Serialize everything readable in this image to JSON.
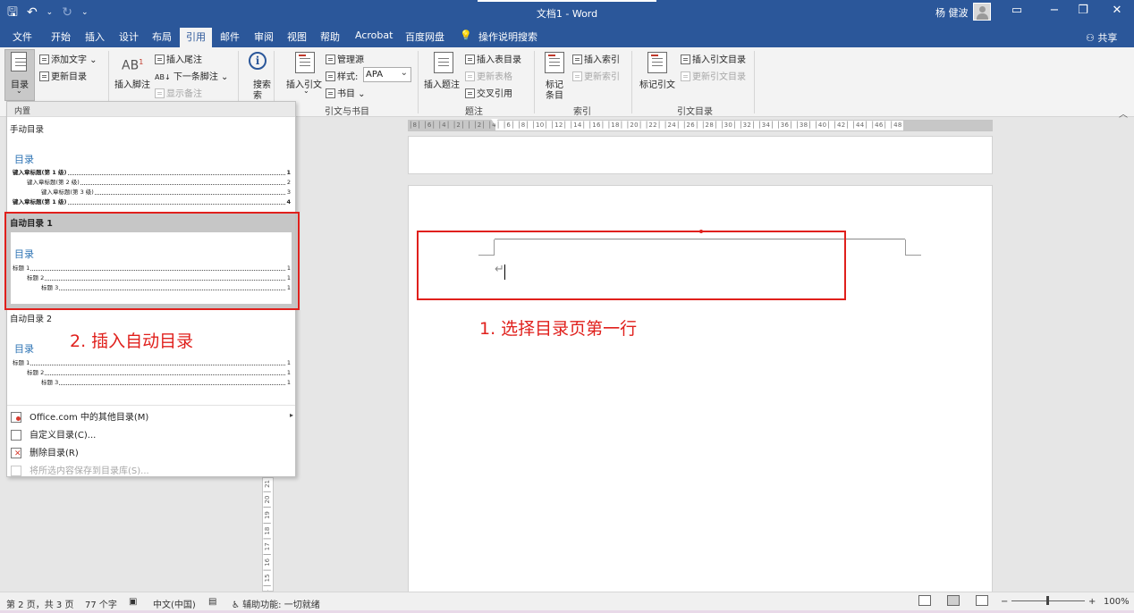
{
  "window": {
    "title": "文档1  -  Word",
    "user_name": "杨 健波",
    "controls": {
      "ribbon_options": "▭",
      "minimize": "−",
      "restore": "❐",
      "close": "✕"
    }
  },
  "qat": {
    "save": "🖫",
    "undo": "↶",
    "undo_more": "⌄",
    "redo": "↻",
    "customize": "⌄"
  },
  "tabs": [
    "文件",
    "开始",
    "插入",
    "设计",
    "布局",
    "引用",
    "邮件",
    "审阅",
    "视图",
    "帮助",
    "Acrobat",
    "百度网盘"
  ],
  "active_tab": "引用",
  "tell_me": "操作说明搜索",
  "share": "共享",
  "ribbon": {
    "toc": {
      "toc_button": "目录",
      "add_text": "添加文字",
      "update_toc": "更新目录"
    },
    "footnotes": {
      "insert_footnote": "插入脚注",
      "insert_endnote": "插入尾注",
      "next_footnote": "下一条脚注",
      "show_notes": "显示备注"
    },
    "research": {
      "search": "搜索"
    },
    "citations": {
      "insert_citation": "插入引文",
      "manage_sources": "管理源",
      "style_label": "样式:",
      "style_value": "APA",
      "bibliography": "书目",
      "group_label": "引文与书目"
    },
    "captions": {
      "insert_caption": "插入题注",
      "insert_table_of_figures": "插入表目录",
      "update_table": "更新表格",
      "cross_reference": "交叉引用",
      "group_label": "题注"
    },
    "index": {
      "mark_entry_line1": "标记",
      "mark_entry_line2": "条目",
      "insert_index": "插入索引",
      "update_index": "更新索引",
      "group_label": "索引"
    },
    "authorities": {
      "mark_citation": "标记引文",
      "insert_toa": "插入引文目录",
      "update_toa": "更新引文目录",
      "group_label": "引文目录"
    }
  },
  "rulers": {
    "horizontal": "│8│  │6│  │4│  │2│  │  │2│  │4│  │6│  │8│  │10│  │12│  │14│  │16│  │18│  │20│  │22│  │24│  │26│  │28│  │30│  │32│  │34│  │36│  │38│  │40│  │42│  │44│  │46│  │48",
    "vertical": "12 │ 13 │ 14 │ 15 │ 16 │ 17 │ 18 │ 19 │ 20 │ 21"
  },
  "gallery": {
    "header": "内置",
    "manual_section": "手动目录",
    "manual_preview": {
      "title": "目录",
      "lines": [
        {
          "text": "键入章标题(第 1 级)",
          "page": "1"
        },
        {
          "text": "键入章标题(第 2 级)",
          "page": "2"
        },
        {
          "text": "键入章标题(第 3 级)",
          "page": "3"
        },
        {
          "text": "键入章标题(第 1 级)",
          "page": "4"
        }
      ]
    },
    "auto1_section": "自动目录 1",
    "auto1_preview": {
      "title": "目录",
      "lines": [
        {
          "text": "标题 1",
          "page": "1"
        },
        {
          "text": "标题 2",
          "page": "1"
        },
        {
          "text": "标题 3",
          "page": "1"
        }
      ]
    },
    "auto2_section": "自动目录 2",
    "auto2_preview": {
      "title": "目录",
      "lines": [
        {
          "text": "标题 1",
          "page": "1"
        },
        {
          "text": "标题 2",
          "page": "1"
        },
        {
          "text": "标题 3",
          "page": "1"
        }
      ]
    },
    "menu": {
      "more_from_office": "Office.com 中的其他目录(M)",
      "custom_toc": "自定义目录(C)...",
      "remove_toc": "删除目录(R)",
      "save_selection": "将所选内容保存到目录库(S)..."
    }
  },
  "annotations": {
    "step1": "1. 选择目录页第一行",
    "step2": "2. 插入自动目录"
  },
  "document": {
    "paragraph_mark": "↵"
  },
  "status": {
    "page": "第 2 页，共 3 页",
    "words": "77 个字",
    "language": "中文(中国)",
    "accessibility": "辅助功能: 一切就绪",
    "zoom": "100%",
    "zoom_minus": "−",
    "zoom_plus": "+"
  },
  "colors": {
    "word_blue": "#2b579a",
    "annotation_red": "#e0201c",
    "toc_heading_blue": "#2e74b5"
  }
}
